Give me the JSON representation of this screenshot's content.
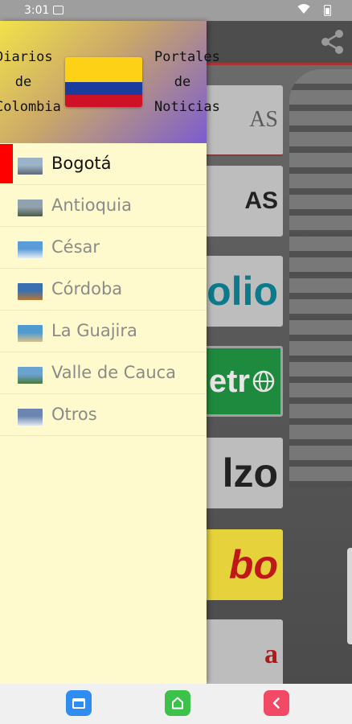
{
  "status_bar": {
    "time": "3:01"
  },
  "drawer": {
    "header": {
      "left_title": "Diarios de Colombia",
      "right_title": "Portales de Noticias"
    },
    "items": [
      {
        "label": "Bogotá",
        "active": true,
        "thumb_colors": [
          "#9bb3c8",
          "#5f6a72"
        ]
      },
      {
        "label": "Antioquia",
        "active": false,
        "thumb_colors": [
          "#8fa2ad",
          "#4e5a44"
        ]
      },
      {
        "label": "César",
        "active": false,
        "thumb_colors": [
          "#5a9bd8",
          "#e8eef2"
        ]
      },
      {
        "label": "Córdoba",
        "active": false,
        "thumb_colors": [
          "#3a6fb0",
          "#b8782e"
        ]
      },
      {
        "label": "La Guajira",
        "active": false,
        "thumb_colors": [
          "#4f9ad1",
          "#d9c08a"
        ]
      },
      {
        "label": "Valle de Cauca",
        "active": false,
        "thumb_colors": [
          "#6aa3d0",
          "#4a7a3a"
        ]
      },
      {
        "label": "Otros",
        "active": false,
        "thumb_colors": [
          "#6c86b0",
          "#e0e6ee"
        ]
      }
    ]
  },
  "background_tiles": [
    "AS",
    "AS",
    "olio",
    "etr",
    "lzo",
    "bo",
    "a"
  ],
  "icons": {
    "share": "share-icon",
    "recent": "recent-apps-icon",
    "home": "home-icon",
    "back": "back-icon"
  },
  "colors": {
    "drawer_bg": "#fffacd",
    "active_marker": "#ff0000",
    "flag_yellow": "#fcd116",
    "flag_blue": "#1b3c9c",
    "flag_red": "#ce1126"
  }
}
